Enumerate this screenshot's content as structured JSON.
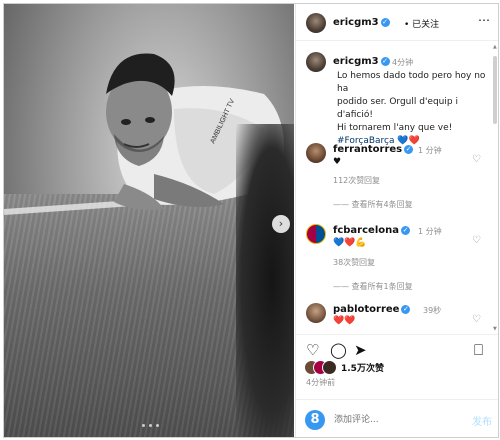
{
  "post": {
    "author": "ericgm3",
    "follow_status": "已关注",
    "caption_time": "4分钟",
    "caption_lines": [
      "Lo hemos dado todo pero hoy no ha",
      "podido ser. Orgull d'equip i d'afició!",
      "Hi tornarem l'any que ve!"
    ],
    "hashtag": "#ForçaBarça",
    "caption_hearts": "💙❤️",
    "image_dots": 3,
    "shirt_text": "AMBILIGHT TV"
  },
  "comments": [
    {
      "user": "ferrantorres",
      "time": "1 分钟",
      "text": "♥",
      "likes": "112次赞",
      "reply": "回复",
      "view_replies": "查看所有4条回复"
    },
    {
      "user": "fcbarcelona",
      "time": "1 分钟",
      "text": "💙❤️💪",
      "likes": "38次赞",
      "reply": "回复",
      "view_replies": "查看所有1条回复"
    },
    {
      "user": "pablotorree",
      "time": "39秒",
      "text": "❤️❤️"
    }
  ],
  "stats": {
    "likes": "1.5万次赞",
    "time": "4分钟前"
  },
  "comment_input": {
    "placeholder": "添加评论...",
    "post_label": "发布"
  },
  "icons": {
    "header_more": "more-icon",
    "actions": [
      "heart-icon",
      "comment-icon",
      "share-icon",
      "save-icon"
    ],
    "emoji": "emoji-icon"
  },
  "colors": {
    "verified": "#3897f0",
    "hashtag": "#00376b",
    "muted": "#8e8e8e"
  }
}
